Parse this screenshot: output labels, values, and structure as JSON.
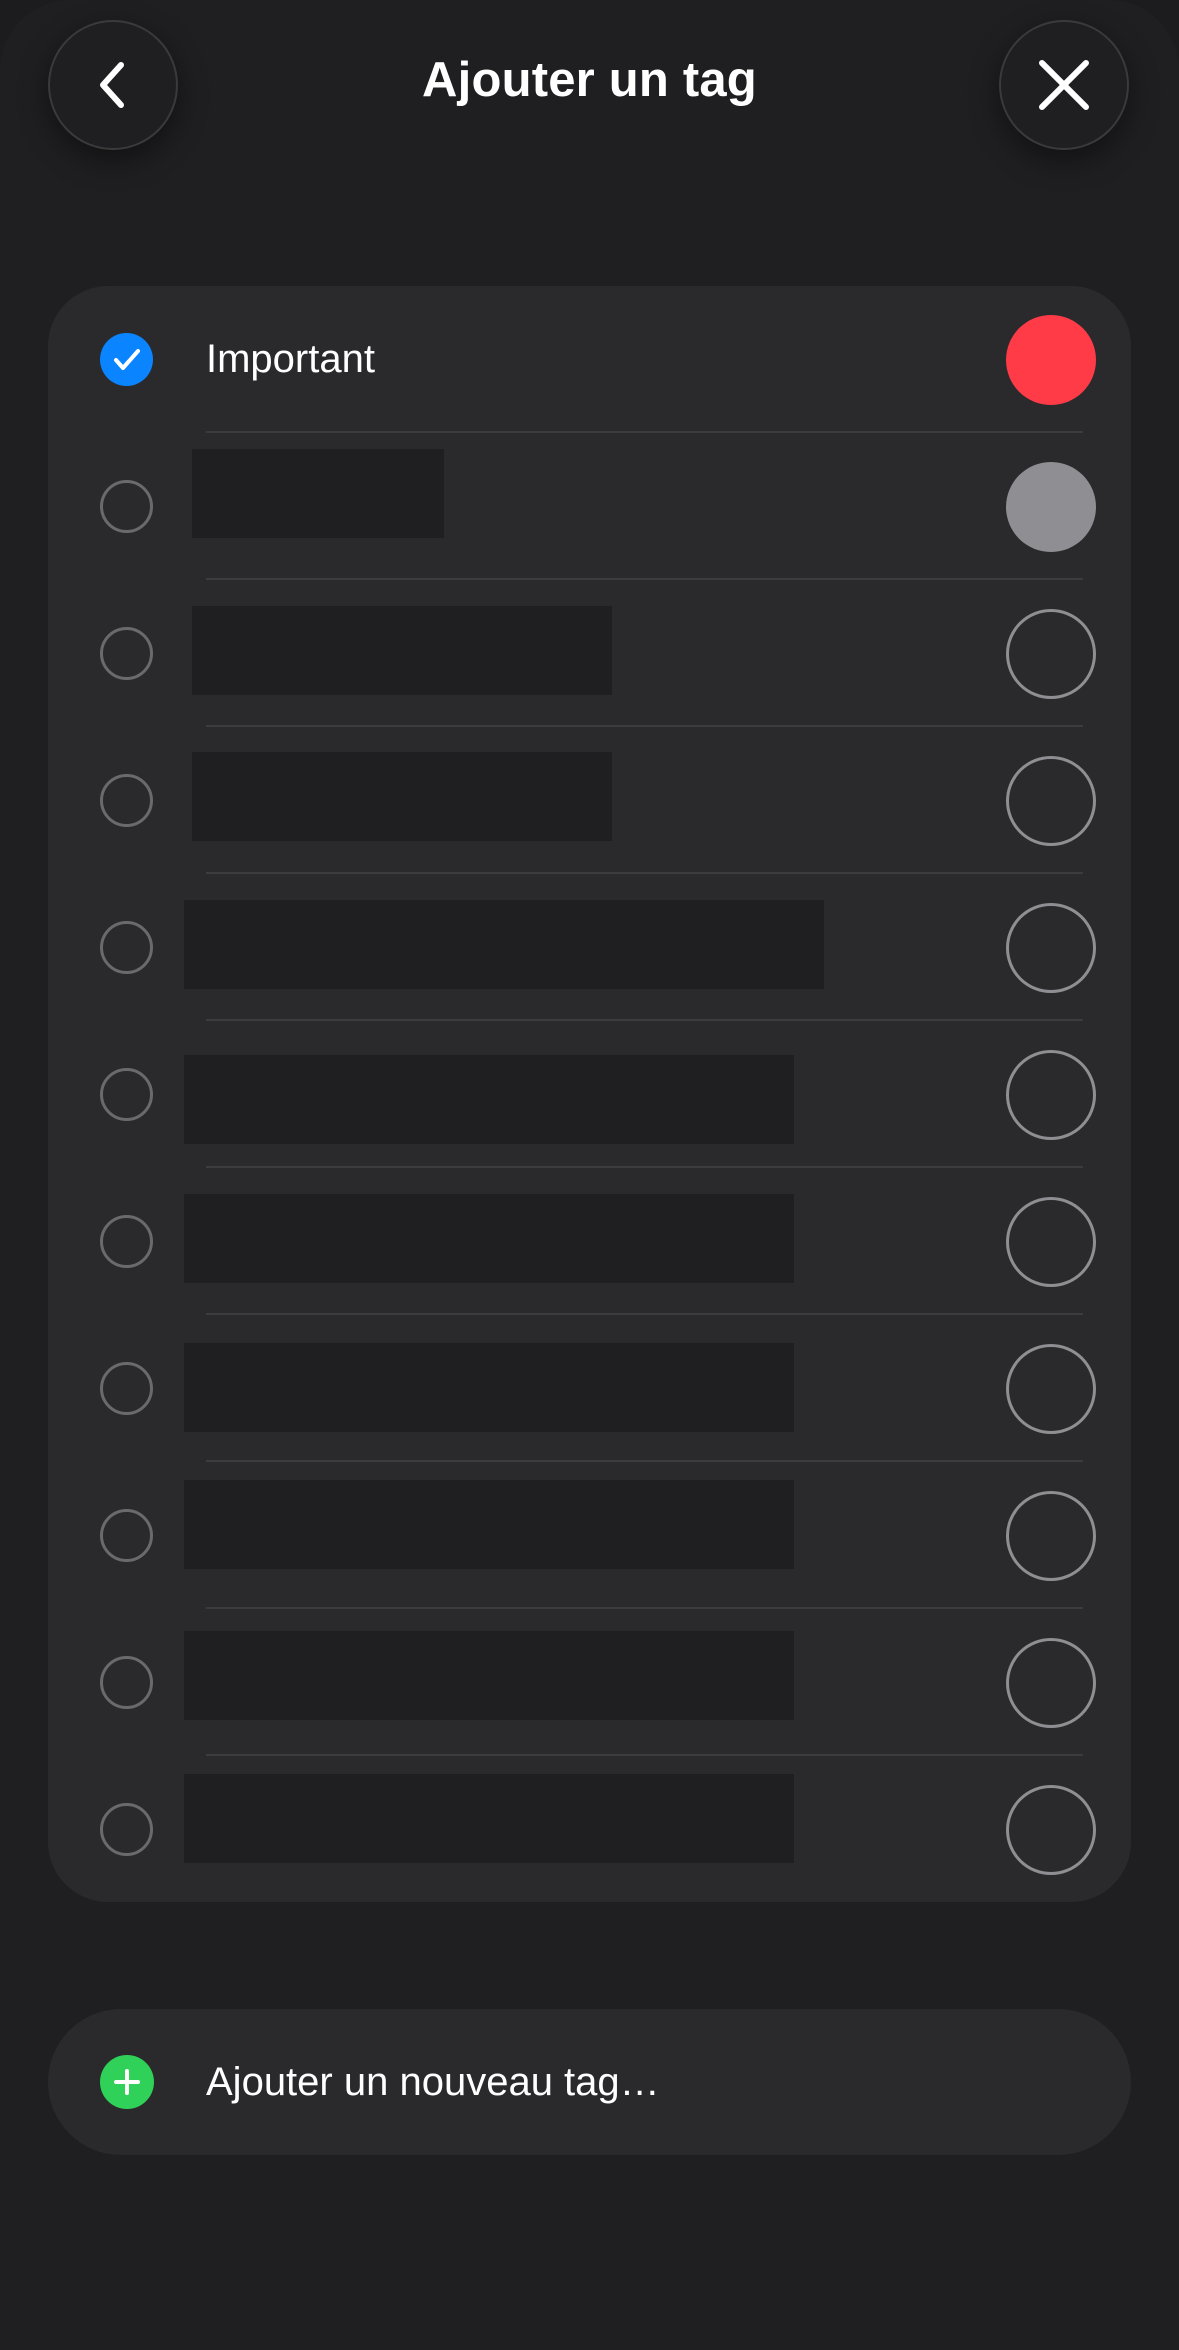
{
  "header": {
    "title": "Ajouter un tag",
    "back_icon": "chevron-left-icon",
    "close_icon": "close-icon"
  },
  "tags": [
    {
      "label": "Important",
      "checked": true,
      "color": "#ff3b47",
      "redacted": false
    },
    {
      "label": "",
      "checked": false,
      "color": "#8e8e93",
      "redacted": true
    },
    {
      "label": "",
      "checked": false,
      "color": null,
      "redacted": true
    },
    {
      "label": "",
      "checked": false,
      "color": null,
      "redacted": true
    },
    {
      "label": "",
      "checked": false,
      "color": null,
      "redacted": true
    },
    {
      "label": "",
      "checked": false,
      "color": null,
      "redacted": true
    },
    {
      "label": "",
      "checked": false,
      "color": null,
      "redacted": true
    },
    {
      "label": "",
      "checked": false,
      "color": null,
      "redacted": true
    },
    {
      "label": "",
      "checked": false,
      "color": null,
      "redacted": true
    },
    {
      "label": "",
      "checked": false,
      "color": null,
      "redacted": true
    },
    {
      "label": "",
      "checked": false,
      "color": null,
      "redacted": true
    }
  ],
  "add_new": {
    "label": "Ajouter un nouveau tag…",
    "icon": "plus-circle-icon",
    "color": "#30d158"
  },
  "colors": {
    "accent": "#0a84ff",
    "background": "#1f1f21",
    "card": "#2a2a2c"
  }
}
